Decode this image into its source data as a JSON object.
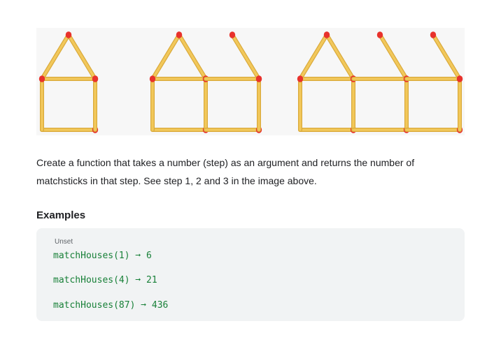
{
  "image": {
    "alt": "Matchstick houses for steps 1, 2 and 3",
    "steps": [
      1,
      2,
      3
    ],
    "colors": {
      "stick": "#f2c85b",
      "stick_edge": "#d9a93a",
      "head": "#e8322c",
      "panel": "#f7f7f7"
    }
  },
  "description": {
    "line1": "Create a function that takes a number (step) as an argument and returns the number of",
    "line2": "matchsticks in that step. See step 1, 2 and 3 in the image above."
  },
  "examples": {
    "heading": "Examples",
    "language_label": "Unset",
    "lines": [
      "matchHouses(1) ➞ 6",
      "matchHouses(4) ➞ 21",
      "matchHouses(87) ➞ 436"
    ]
  }
}
